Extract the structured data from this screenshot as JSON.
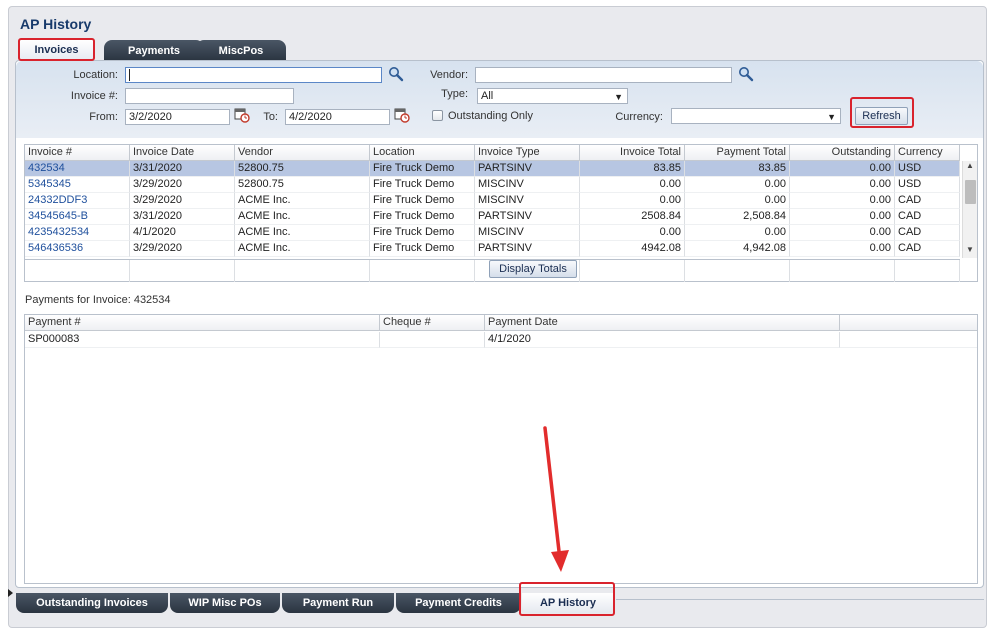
{
  "title": "AP History",
  "tabs": [
    "Invoices",
    "Payments",
    "MiscPos"
  ],
  "filters": {
    "location_label": "Location:",
    "location_value": "",
    "vendor_label": "Vendor:",
    "vendor_value": "",
    "invoice_label": "Invoice #:",
    "invoice_value": "",
    "type_label": "Type:",
    "type_value": "All",
    "from_label": "From:",
    "from_value": "3/2/2020",
    "to_label": "To:",
    "to_value": "4/2/2020",
    "outstanding_label": "Outstanding Only",
    "outstanding_checked": false,
    "currency_label": "Currency:",
    "currency_value": "",
    "refresh_label": "Refresh"
  },
  "invoices": {
    "columns": [
      "Invoice #",
      "Invoice Date",
      "Vendor",
      "Location",
      "Invoice Type",
      "Invoice Total",
      "Payment Total",
      "Outstanding",
      "Currency"
    ],
    "rows": [
      [
        "432534",
        "3/31/2020",
        "52800.75",
        "Fire Truck Demo",
        "PARTSINV",
        "83.85",
        "83.85",
        "0.00",
        "USD"
      ],
      [
        "5345345",
        "3/29/2020",
        "52800.75",
        "Fire Truck Demo",
        "MISCINV",
        "0.00",
        "0.00",
        "0.00",
        "USD"
      ],
      [
        "24332DDF3",
        "3/29/2020",
        "ACME Inc.",
        "Fire Truck Demo",
        "MISCINV",
        "0.00",
        "0.00",
        "0.00",
        "CAD"
      ],
      [
        "34545645-B",
        "3/31/2020",
        "ACME Inc.",
        "Fire Truck Demo",
        "PARTSINV",
        "2508.84",
        "2,508.84",
        "0.00",
        "CAD"
      ],
      [
        "4235432534",
        "4/1/2020",
        "ACME Inc.",
        "Fire Truck Demo",
        "MISCINV",
        "0.00",
        "0.00",
        "0.00",
        "CAD"
      ],
      [
        "546436536",
        "3/29/2020",
        "ACME Inc.",
        "Fire Truck Demo",
        "PARTSINV",
        "4942.08",
        "4,942.08",
        "0.00",
        "CAD"
      ]
    ],
    "selected_row": 0,
    "display_totals_label": "Display Totals"
  },
  "payments_caption": "Payments for Invoice: 432534",
  "payments": {
    "columns": [
      "Payment #",
      "Cheque #",
      "Payment Date",
      ""
    ],
    "rows": [
      [
        "SP000083",
        "",
        "4/1/2020",
        ""
      ]
    ]
  },
  "bottom_tabs": [
    "Outstanding Invoices",
    "WIP Misc POs",
    "Payment Run",
    "Payment Credits",
    "AP History"
  ],
  "colors": {
    "accent": "#173a6b",
    "highlight": "#d9232d",
    "selected_row": "#b7c6e2"
  }
}
